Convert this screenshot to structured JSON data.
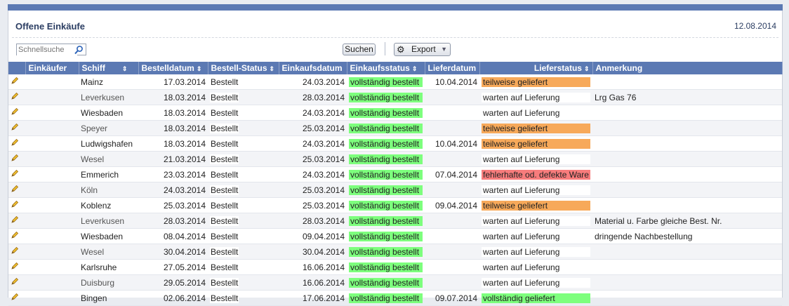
{
  "header": {
    "title": "Offene Einkäufe",
    "date": "12.08.2014"
  },
  "toolbar": {
    "search_placeholder": "Schnellsuche",
    "search_label": "Suchen",
    "export_label": "Export"
  },
  "columns": [
    "",
    "Einkäufer",
    "Schiff",
    "Bestelldatum",
    "Bestell-Status",
    "Einkaufsdatum",
    "Einkaufsstatus",
    "Lieferdatum",
    "Lieferstatus",
    "Anmerkung"
  ],
  "colors": {
    "header": "#5b79b3",
    "green": "#7dff7d",
    "orange": "#f7a95a",
    "red": "#f77c7c"
  },
  "rows": [
    {
      "schiff": "Mainz",
      "bestelldatum": "17.03.2014",
      "bestellstatus": "Bestellt",
      "einkaufsdatum": "24.03.2014",
      "einkaufsstatus": "vollständig bestellt",
      "lieferdatum": "10.04.2014",
      "lieferstatus": "teilweise geliefert",
      "status_color": "orange",
      "anmerkung": ""
    },
    {
      "schiff": "Leverkusen",
      "bestelldatum": "18.03.2014",
      "bestellstatus": "Bestellt",
      "einkaufsdatum": "28.03.2014",
      "einkaufsstatus": "vollständig bestellt",
      "lieferdatum": "",
      "lieferstatus": "warten auf Lieferung",
      "status_color": "white",
      "anmerkung": "Lrg Gas 76"
    },
    {
      "schiff": "Wiesbaden",
      "bestelldatum": "18.03.2014",
      "bestellstatus": "Bestellt",
      "einkaufsdatum": "24.03.2014",
      "einkaufsstatus": "vollständig bestellt",
      "lieferdatum": "",
      "lieferstatus": "warten auf Lieferung",
      "status_color": "white",
      "anmerkung": ""
    },
    {
      "schiff": "Speyer",
      "bestelldatum": "18.03.2014",
      "bestellstatus": "Bestellt",
      "einkaufsdatum": "25.03.2014",
      "einkaufsstatus": "vollständig bestellt",
      "lieferdatum": "",
      "lieferstatus": "teilweise geliefert",
      "status_color": "orange",
      "anmerkung": ""
    },
    {
      "schiff": "Ludwigshafen",
      "bestelldatum": "18.03.2014",
      "bestellstatus": "Bestellt",
      "einkaufsdatum": "24.03.2014",
      "einkaufsstatus": "vollständig bestellt",
      "lieferdatum": "10.04.2014",
      "lieferstatus": "teilweise geliefert",
      "status_color": "orange",
      "anmerkung": ""
    },
    {
      "schiff": "Wesel",
      "bestelldatum": "21.03.2014",
      "bestellstatus": "Bestellt",
      "einkaufsdatum": "25.03.2014",
      "einkaufsstatus": "vollständig bestellt",
      "lieferdatum": "",
      "lieferstatus": "warten auf Lieferung",
      "status_color": "white",
      "anmerkung": ""
    },
    {
      "schiff": "Emmerich",
      "bestelldatum": "23.03.2014",
      "bestellstatus": "Bestellt",
      "einkaufsdatum": "24.03.2014",
      "einkaufsstatus": "vollständig bestellt",
      "lieferdatum": "07.04.2014",
      "lieferstatus": "fehlerhafte od. defekte Ware",
      "status_color": "red",
      "anmerkung": ""
    },
    {
      "schiff": "Köln",
      "bestelldatum": "24.03.2014",
      "bestellstatus": "Bestellt",
      "einkaufsdatum": "25.03.2014",
      "einkaufsstatus": "vollständig bestellt",
      "lieferdatum": "",
      "lieferstatus": "warten auf Lieferung",
      "status_color": "white",
      "anmerkung": ""
    },
    {
      "schiff": "Koblenz",
      "bestelldatum": "25.03.2014",
      "bestellstatus": "Bestellt",
      "einkaufsdatum": "25.03.2014",
      "einkaufsstatus": "vollständig bestellt",
      "lieferdatum": "09.04.2014",
      "lieferstatus": "teilweise geliefert",
      "status_color": "orange",
      "anmerkung": ""
    },
    {
      "schiff": "Leverkusen",
      "bestelldatum": "28.03.2014",
      "bestellstatus": "Bestellt",
      "einkaufsdatum": "28.03.2014",
      "einkaufsstatus": "vollständig bestellt",
      "lieferdatum": "",
      "lieferstatus": "warten auf Lieferung",
      "status_color": "white",
      "anmerkung": "Material u. Farbe gleiche Best. Nr."
    },
    {
      "schiff": "Wiesbaden",
      "bestelldatum": "08.04.2014",
      "bestellstatus": "Bestellt",
      "einkaufsdatum": "09.04.2014",
      "einkaufsstatus": "vollständig bestellt",
      "lieferdatum": "",
      "lieferstatus": "warten auf Lieferung",
      "status_color": "white",
      "anmerkung": "dringende Nachbestellung"
    },
    {
      "schiff": "Wesel",
      "bestelldatum": "30.04.2014",
      "bestellstatus": "Bestellt",
      "einkaufsdatum": "30.04.2014",
      "einkaufsstatus": "vollständig bestellt",
      "lieferdatum": "",
      "lieferstatus": "warten auf Lieferung",
      "status_color": "white",
      "anmerkung": ""
    },
    {
      "schiff": "Karlsruhe",
      "bestelldatum": "27.05.2014",
      "bestellstatus": "Bestellt",
      "einkaufsdatum": "16.06.2014",
      "einkaufsstatus": "vollständig bestellt",
      "lieferdatum": "",
      "lieferstatus": "warten auf Lieferung",
      "status_color": "white",
      "anmerkung": ""
    },
    {
      "schiff": "Duisburg",
      "bestelldatum": "29.05.2014",
      "bestellstatus": "Bestellt",
      "einkaufsdatum": "16.06.2014",
      "einkaufsstatus": "vollständig bestellt",
      "lieferdatum": "",
      "lieferstatus": "warten auf Lieferung",
      "status_color": "white",
      "anmerkung": ""
    },
    {
      "schiff": "Bingen",
      "bestelldatum": "02.06.2014",
      "bestellstatus": "Bestellt",
      "einkaufsdatum": "17.06.2014",
      "einkaufsstatus": "vollständig bestellt",
      "lieferdatum": "09.07.2014",
      "lieferstatus": "vollständig geliefert",
      "status_color": "green",
      "anmerkung": ""
    }
  ]
}
